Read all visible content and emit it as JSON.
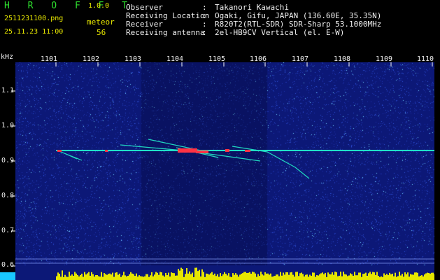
{
  "header": {
    "app_title": "H R O F F T",
    "app_version": "1.0.0",
    "file_name": "2511231100.png",
    "datetime": "25.11.23 11:00",
    "meteor_label": "meteor",
    "meteor_count": "56"
  },
  "info": [
    {
      "key": "Observer",
      "value": "Takanori Kawachi"
    },
    {
      "key": "Receiving Location",
      "value": "Ogaki, Gifu, JAPAN (136.60E, 35.35N)"
    },
    {
      "key": "Receiver",
      "value": "R820T2(RTL-SDR) SDR-Sharp 53.1000MHz"
    },
    {
      "key": "Receiving antenna",
      "value": "2el-HB9CV Vertical (el. E-W)"
    }
  ],
  "axis": {
    "y_unit": "kHz",
    "time_labels": [
      "1101",
      "1102",
      "1103",
      "1104",
      "1105",
      "1106",
      "1107",
      "1108",
      "1109",
      "1110"
    ],
    "freq_labels": [
      "1.1",
      "1.0",
      "0.9",
      "0.8",
      "0.7",
      "0.6"
    ]
  },
  "colors": {
    "background": "#0c1877",
    "carrier": "#20e0c8",
    "burst": "#ff3344",
    "bars": "#e6e600",
    "header_green": "#2fe02f",
    "header_yellow": "#e8e800"
  }
}
